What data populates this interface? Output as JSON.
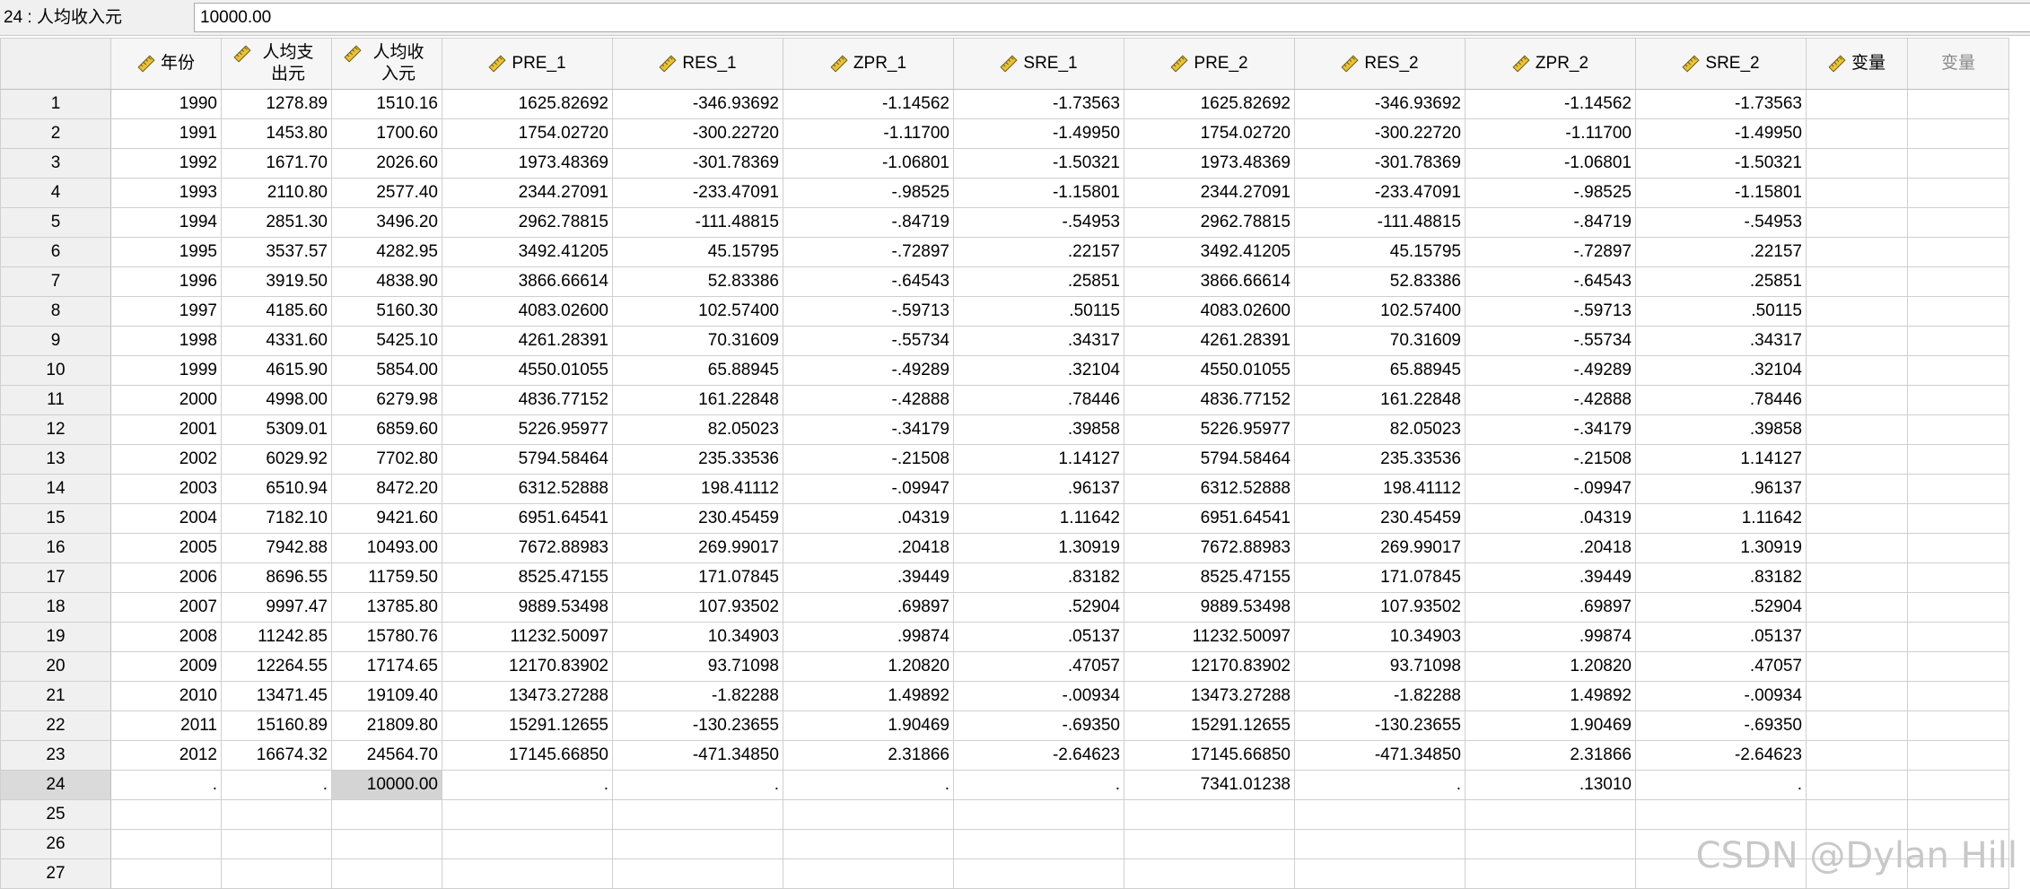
{
  "cell_editor": {
    "cell_ref": "24 : 人均收入元",
    "value": "10000.00"
  },
  "columns": [
    "年份",
    "人均支出元",
    "人均收入元",
    "PRE_1",
    "RES_1",
    "ZPR_1",
    "SRE_1",
    "PRE_2",
    "RES_2",
    "ZPR_2",
    "SRE_2",
    "变量",
    "变量"
  ],
  "rows": [
    [
      "1",
      "1990",
      "1278.89",
      "1510.16",
      "1625.82692",
      "-346.93692",
      "-1.14562",
      "-1.73563",
      "1625.82692",
      "-346.93692",
      "-1.14562",
      "-1.73563",
      "",
      ""
    ],
    [
      "2",
      "1991",
      "1453.80",
      "1700.60",
      "1754.02720",
      "-300.22720",
      "-1.11700",
      "-1.49950",
      "1754.02720",
      "-300.22720",
      "-1.11700",
      "-1.49950",
      "",
      ""
    ],
    [
      "3",
      "1992",
      "1671.70",
      "2026.60",
      "1973.48369",
      "-301.78369",
      "-1.06801",
      "-1.50321",
      "1973.48369",
      "-301.78369",
      "-1.06801",
      "-1.50321",
      "",
      ""
    ],
    [
      "4",
      "1993",
      "2110.80",
      "2577.40",
      "2344.27091",
      "-233.47091",
      "-.98525",
      "-1.15801",
      "2344.27091",
      "-233.47091",
      "-.98525",
      "-1.15801",
      "",
      ""
    ],
    [
      "5",
      "1994",
      "2851.30",
      "3496.20",
      "2962.78815",
      "-111.48815",
      "-.84719",
      "-.54953",
      "2962.78815",
      "-111.48815",
      "-.84719",
      "-.54953",
      "",
      ""
    ],
    [
      "6",
      "1995",
      "3537.57",
      "4282.95",
      "3492.41205",
      "45.15795",
      "-.72897",
      ".22157",
      "3492.41205",
      "45.15795",
      "-.72897",
      ".22157",
      "",
      ""
    ],
    [
      "7",
      "1996",
      "3919.50",
      "4838.90",
      "3866.66614",
      "52.83386",
      "-.64543",
      ".25851",
      "3866.66614",
      "52.83386",
      "-.64543",
      ".25851",
      "",
      ""
    ],
    [
      "8",
      "1997",
      "4185.60",
      "5160.30",
      "4083.02600",
      "102.57400",
      "-.59713",
      ".50115",
      "4083.02600",
      "102.57400",
      "-.59713",
      ".50115",
      "",
      ""
    ],
    [
      "9",
      "1998",
      "4331.60",
      "5425.10",
      "4261.28391",
      "70.31609",
      "-.55734",
      ".34317",
      "4261.28391",
      "70.31609",
      "-.55734",
      ".34317",
      "",
      ""
    ],
    [
      "10",
      "1999",
      "4615.90",
      "5854.00",
      "4550.01055",
      "65.88945",
      "-.49289",
      ".32104",
      "4550.01055",
      "65.88945",
      "-.49289",
      ".32104",
      "",
      ""
    ],
    [
      "11",
      "2000",
      "4998.00",
      "6279.98",
      "4836.77152",
      "161.22848",
      "-.42888",
      ".78446",
      "4836.77152",
      "161.22848",
      "-.42888",
      ".78446",
      "",
      ""
    ],
    [
      "12",
      "2001",
      "5309.01",
      "6859.60",
      "5226.95977",
      "82.05023",
      "-.34179",
      ".39858",
      "5226.95977",
      "82.05023",
      "-.34179",
      ".39858",
      "",
      ""
    ],
    [
      "13",
      "2002",
      "6029.92",
      "7702.80",
      "5794.58464",
      "235.33536",
      "-.21508",
      "1.14127",
      "5794.58464",
      "235.33536",
      "-.21508",
      "1.14127",
      "",
      ""
    ],
    [
      "14",
      "2003",
      "6510.94",
      "8472.20",
      "6312.52888",
      "198.41112",
      "-.09947",
      ".96137",
      "6312.52888",
      "198.41112",
      "-.09947",
      ".96137",
      "",
      ""
    ],
    [
      "15",
      "2004",
      "7182.10",
      "9421.60",
      "6951.64541",
      "230.45459",
      ".04319",
      "1.11642",
      "6951.64541",
      "230.45459",
      ".04319",
      "1.11642",
      "",
      ""
    ],
    [
      "16",
      "2005",
      "7942.88",
      "10493.00",
      "7672.88983",
      "269.99017",
      ".20418",
      "1.30919",
      "7672.88983",
      "269.99017",
      ".20418",
      "1.30919",
      "",
      ""
    ],
    [
      "17",
      "2006",
      "8696.55",
      "11759.50",
      "8525.47155",
      "171.07845",
      ".39449",
      ".83182",
      "8525.47155",
      "171.07845",
      ".39449",
      ".83182",
      "",
      ""
    ],
    [
      "18",
      "2007",
      "9997.47",
      "13785.80",
      "9889.53498",
      "107.93502",
      ".69897",
      ".52904",
      "9889.53498",
      "107.93502",
      ".69897",
      ".52904",
      "",
      ""
    ],
    [
      "19",
      "2008",
      "11242.85",
      "15780.76",
      "11232.50097",
      "10.34903",
      ".99874",
      ".05137",
      "11232.50097",
      "10.34903",
      ".99874",
      ".05137",
      "",
      ""
    ],
    [
      "20",
      "2009",
      "12264.55",
      "17174.65",
      "12170.83902",
      "93.71098",
      "1.20820",
      ".47057",
      "12170.83902",
      "93.71098",
      "1.20820",
      ".47057",
      "",
      ""
    ],
    [
      "21",
      "2010",
      "13471.45",
      "19109.40",
      "13473.27288",
      "-1.82288",
      "1.49892",
      "-.00934",
      "13473.27288",
      "-1.82288",
      "1.49892",
      "-.00934",
      "",
      ""
    ],
    [
      "22",
      "2011",
      "15160.89",
      "21809.80",
      "15291.12655",
      "-130.23655",
      "1.90469",
      "-.69350",
      "15291.12655",
      "-130.23655",
      "1.90469",
      "-.69350",
      "",
      ""
    ],
    [
      "23",
      "2012",
      "16674.32",
      "24564.70",
      "17145.66850",
      "-471.34850",
      "2.31866",
      "-2.64623",
      "17145.66850",
      "-471.34850",
      "2.31866",
      "-2.64623",
      "",
      ""
    ],
    [
      "24",
      ".",
      ".",
      "10000.00",
      ".",
      ".",
      ".",
      ".",
      "7341.01238",
      ".",
      ".13010",
      ".",
      "",
      ""
    ],
    [
      "25",
      "",
      "",
      "",
      "",
      "",
      "",
      "",
      "",
      "",
      "",
      "",
      "",
      ""
    ],
    [
      "26",
      "",
      "",
      "",
      "",
      "",
      "",
      "",
      "",
      "",
      "",
      "",
      "",
      ""
    ],
    [
      "27",
      "",
      "",
      "",
      "",
      "",
      "",
      "",
      "",
      "",
      "",
      "",
      "",
      ""
    ]
  ],
  "selected_cell": {
    "row": 24,
    "column": "人均收入元"
  },
  "watermark": "CSDN @Dylan Hill",
  "colors": {
    "selected_cell": "#d4d4d4",
    "header_bg": "#f6f6f6",
    "gridline": "#cfcfcf"
  }
}
